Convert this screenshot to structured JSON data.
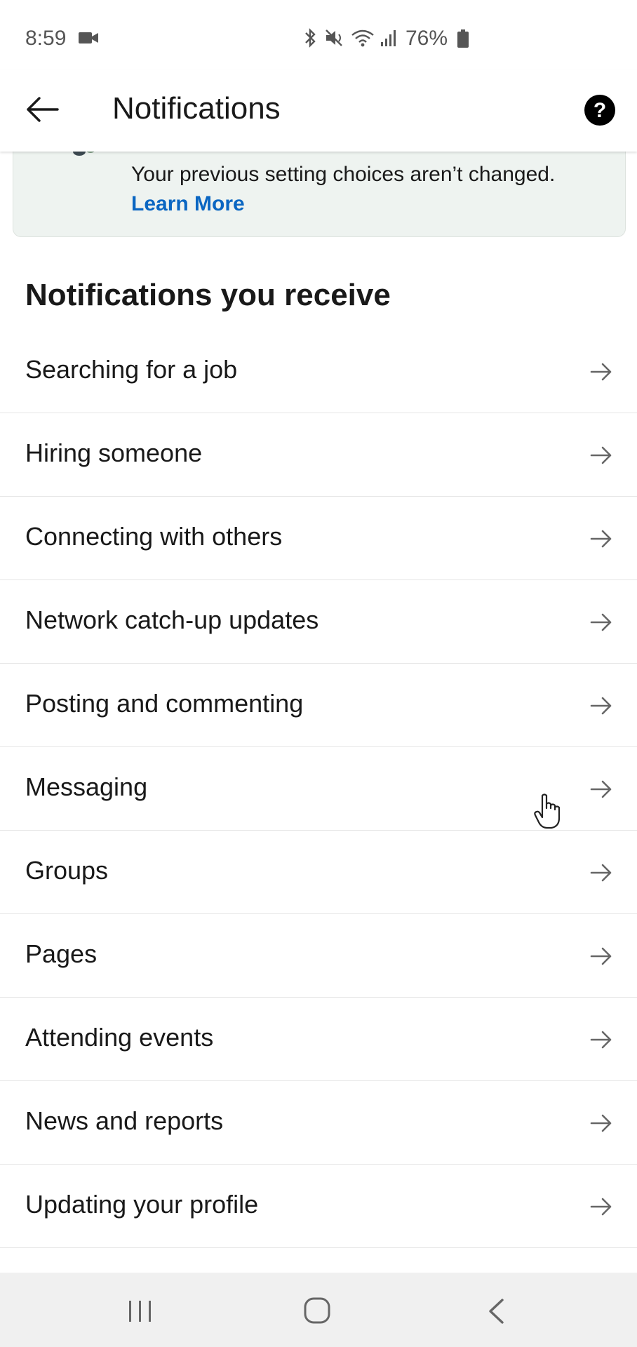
{
  "status_bar": {
    "time": "8:59",
    "battery": "76%"
  },
  "header": {
    "title": "Notifications"
  },
  "banner": {
    "text": "Your previous setting choices aren’t changed.",
    "link": "Learn More"
  },
  "section": {
    "title": "Notifications you receive"
  },
  "settings": [
    {
      "label": "Searching for a job"
    },
    {
      "label": "Hiring someone"
    },
    {
      "label": "Connecting with others"
    },
    {
      "label": "Network catch-up updates"
    },
    {
      "label": "Posting and commenting"
    },
    {
      "label": "Messaging"
    },
    {
      "label": "Groups"
    },
    {
      "label": "Pages"
    },
    {
      "label": "Attending events"
    },
    {
      "label": "News and reports"
    },
    {
      "label": "Updating your profile"
    }
  ],
  "colors": {
    "link": "#0a66c2",
    "text": "#191919",
    "banner_bg": "#eef3f0"
  },
  "icons": {
    "back": "arrow-left-icon",
    "help": "question-circle-icon",
    "row": "arrow-right-icon"
  }
}
